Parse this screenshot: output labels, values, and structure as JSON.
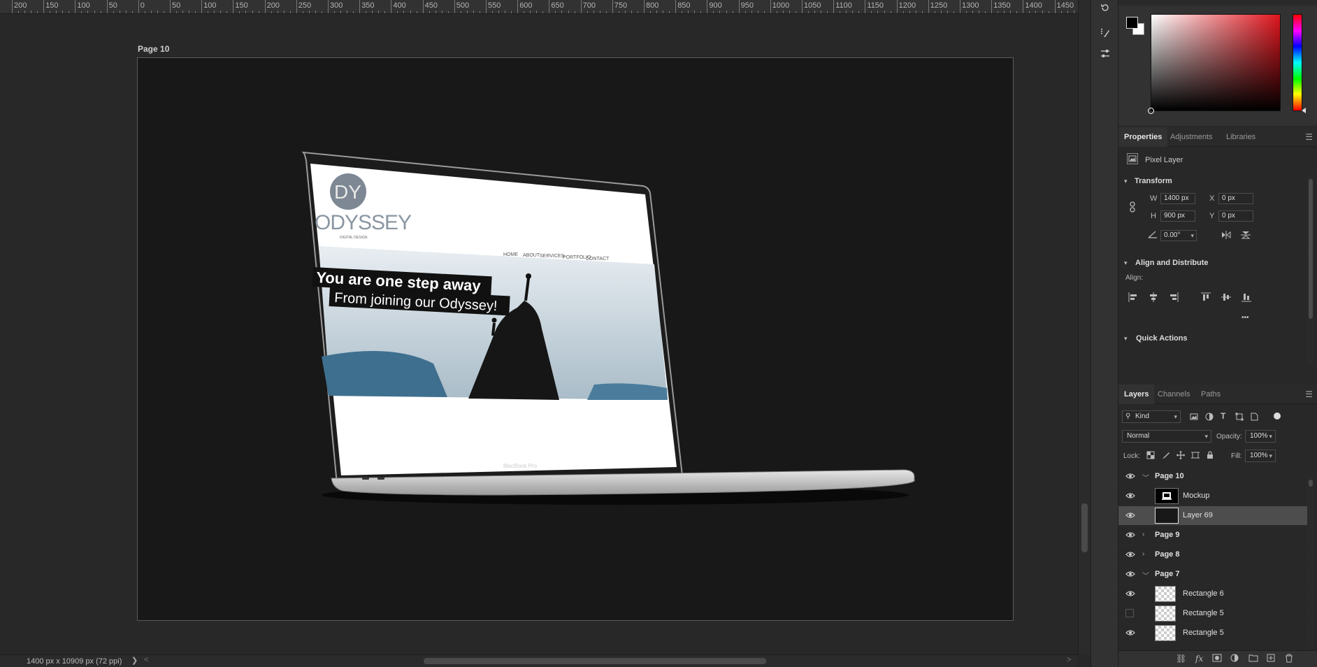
{
  "ruler": {
    "labels": [
      "200",
      "150",
      "100",
      "50",
      "0",
      "50",
      "100",
      "150",
      "200",
      "250",
      "300",
      "350",
      "400",
      "450",
      "500",
      "550",
      "600",
      "650",
      "700",
      "750",
      "800",
      "850",
      "900",
      "950",
      "1000",
      "1050",
      "1100",
      "1150",
      "1200",
      "1250",
      "1300",
      "1350",
      "1400",
      "1450"
    ]
  },
  "canvas": {
    "artboard_label": "Page 10"
  },
  "mockup": {
    "logo_letters": "DY",
    "brand_name": "ODYSSEY",
    "brand_tagline": "DIGITAL DESIGN",
    "nav_items": [
      "HOME",
      "ABOUT",
      "SERVICES",
      "PORTFOLIO",
      "CONTACT"
    ],
    "headline_1": "You are one step away",
    "headline_2": "From joining our Odyssey!",
    "device_label": "MacBook Pro"
  },
  "status": {
    "doc_size": "1400 px x 10909 px (72 ppi)",
    "arrow": "❯",
    "scroll_left": "<",
    "scroll_right": ">"
  },
  "color_panel": {
    "fg_color": "#000000",
    "bg_color": "#ffffff"
  },
  "properties": {
    "tabs": [
      "Properties",
      "Adjustments",
      "Libraries"
    ],
    "layer_type": "Pixel Layer",
    "transform_title": "Transform",
    "w_label": "W",
    "w_value": "1400 px",
    "h_label": "H",
    "h_value": "900 px",
    "x_label": "X",
    "x_value": "0 px",
    "y_label": "Y",
    "y_value": "0 px",
    "angle_value": "0.00°",
    "align_title": "Align and Distribute",
    "align_label": "Align:",
    "more": "•••",
    "quick_actions_title": "Quick Actions"
  },
  "layers_panel": {
    "tabs": [
      "Layers",
      "Channels",
      "Paths"
    ],
    "filter_kind": "Kind",
    "blend_mode": "Normal",
    "opacity_label": "Opacity:",
    "opacity_value": "100%",
    "lock_label": "Lock:",
    "fill_label": "Fill:",
    "fill_value": "100%",
    "layers": [
      {
        "name": "Page 10",
        "kind": "group",
        "expanded": true,
        "visible": true
      },
      {
        "name": "Mockup",
        "kind": "smart",
        "visible": true
      },
      {
        "name": "Layer 69",
        "kind": "pixel",
        "visible": true,
        "selected": true
      },
      {
        "name": "Page 9",
        "kind": "group",
        "expanded": false,
        "visible": true
      },
      {
        "name": "Page 8",
        "kind": "group",
        "expanded": false,
        "visible": true
      },
      {
        "name": "Page 7",
        "kind": "group",
        "expanded": true,
        "visible": true
      },
      {
        "name": "Rectangle 6",
        "kind": "shape",
        "visible": true
      },
      {
        "name": "Rectangle 5",
        "kind": "shape",
        "visible": false
      },
      {
        "name": "Rectangle 5",
        "kind": "shape",
        "visible": true
      }
    ]
  },
  "colors": {
    "accent": "#e0151d",
    "panel_bg": "#323232",
    "canvas_bg": "#282828",
    "artboard_bg": "#181818"
  }
}
